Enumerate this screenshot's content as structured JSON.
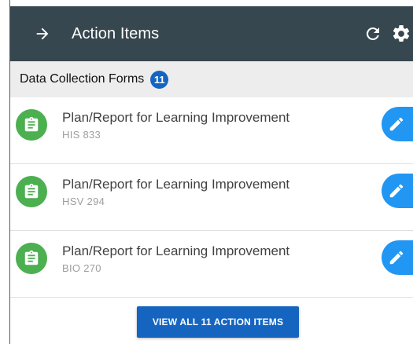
{
  "header": {
    "title": "Action Items",
    "back_icon": "arrow-right-icon",
    "refresh_icon": "refresh-icon",
    "settings_icon": "gear-icon",
    "background": "#37474f"
  },
  "section": {
    "label": "Data Collection Forms",
    "count": "11",
    "badge_color": "#1565c0"
  },
  "items": [
    {
      "title": "Plan/Report for Learning Improvement",
      "subtitle": "HIS 833",
      "icon": "clipboard-icon",
      "action_icon": "pencil-icon"
    },
    {
      "title": "Plan/Report for Learning Improvement",
      "subtitle": "HSV 294",
      "icon": "clipboard-icon",
      "action_icon": "pencil-icon"
    },
    {
      "title": "Plan/Report for Learning Improvement",
      "subtitle": "BIO 270",
      "icon": "clipboard-icon",
      "action_icon": "pencil-icon"
    }
  ],
  "footer": {
    "view_all_label": "VIEW ALL 11 ACTION ITEMS"
  },
  "colors": {
    "avatar_green": "#4caf50",
    "edit_blue": "#2196f3",
    "primary_blue": "#1565c0"
  }
}
